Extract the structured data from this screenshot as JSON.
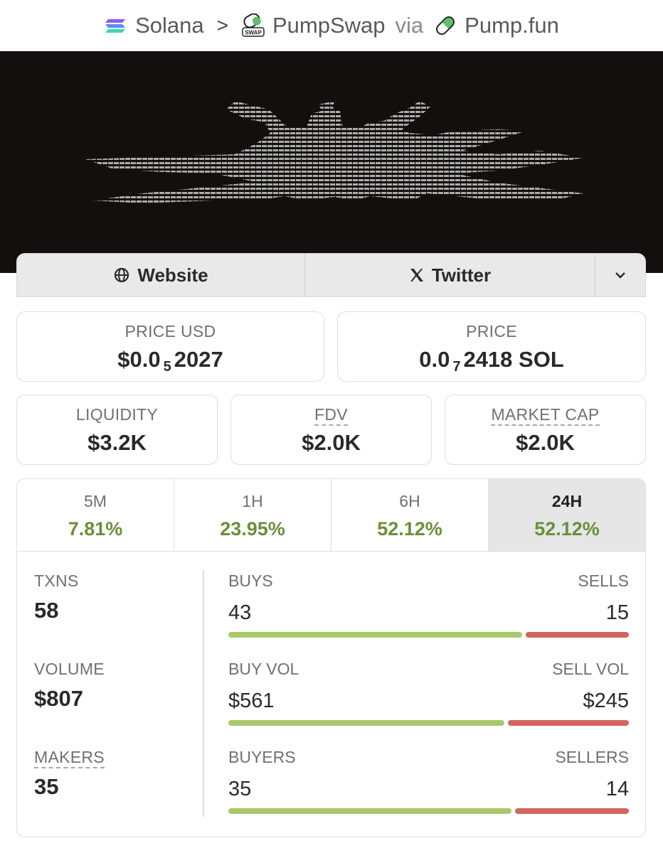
{
  "breadcrumb": {
    "chain": "Solana",
    "dex": "PumpSwap",
    "via": "via",
    "launchpad": "Pump.fun",
    "swap_badge": "SWAP"
  },
  "links": {
    "website": "Website",
    "twitter": "Twitter"
  },
  "price": {
    "usd_label": "PRICE USD",
    "usd_prefix": "$0.0",
    "usd_sub": "5",
    "usd_suffix": "2027",
    "native_label": "PRICE",
    "native_prefix": "0.0",
    "native_sub": "7",
    "native_suffix": "2418 SOL"
  },
  "metrics": {
    "liquidity_label": "LIQUIDITY",
    "liquidity": "$3.2K",
    "fdv_label": "FDV",
    "fdv": "$2.0K",
    "mcap_label": "MARKET CAP",
    "mcap": "$2.0K"
  },
  "timeframes": [
    {
      "label": "5M",
      "change": "7.81%"
    },
    {
      "label": "1H",
      "change": "23.95%"
    },
    {
      "label": "6H",
      "change": "52.12%"
    },
    {
      "label": "24H",
      "change": "52.12%"
    }
  ],
  "stats": {
    "txns_label": "TXNS",
    "txns": "58",
    "volume_label": "VOLUME",
    "volume": "$807",
    "makers_label": "MAKERS",
    "makers": "35",
    "buys_label": "BUYS",
    "buys": "43",
    "sells_label": "SELLS",
    "sells": "15",
    "buyvol_label": "BUY VOL",
    "buyvol": "$561",
    "sellvol_label": "SELL VOL",
    "sellvol": "$245",
    "buyers_label": "BUYERS",
    "buyers": "35",
    "sellers_label": "SELLERS",
    "sellers": "14"
  },
  "ratios": {
    "buys": 0.741,
    "buy_volume": 0.696,
    "buyers": 0.714
  },
  "colors": {
    "positive": "#6b8f3a",
    "buy_bar": "#a9c96a",
    "sell_bar": "#d3655a"
  }
}
